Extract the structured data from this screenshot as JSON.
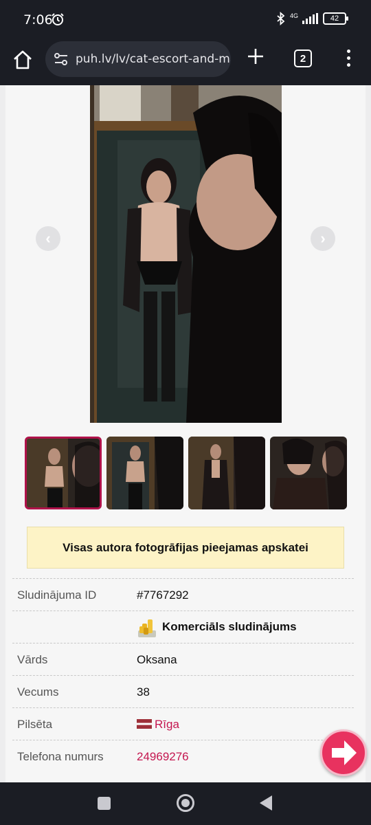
{
  "status_bar": {
    "time": "7:06",
    "battery": "42",
    "network": "4G"
  },
  "browser": {
    "url": "puh.lv/lv/cat-escort-and-ma",
    "tab_count": "2"
  },
  "gallery": {
    "prev_label": "‹",
    "next_label": "›",
    "thumbnail_count": 4,
    "active_thumbnail": 1
  },
  "notice": {
    "text": "Visas autora fotogrāfijas pieejamas apskatei"
  },
  "details": {
    "ad_id_label": "Sludinājuma ID",
    "ad_id": "#7767292",
    "commercial_label": "Komerciāls sludinājums",
    "name_label": "Vārds",
    "name": "Oksana",
    "age_label": "Vecums",
    "age": "38",
    "city_label": "Pilsēta",
    "city": "Rīga",
    "phone_label": "Telefona numurs",
    "phone": "24969276"
  },
  "colors": {
    "accent": "#c4164f",
    "notice_bg": "#fdf3c6",
    "fab": "#e8325f"
  }
}
